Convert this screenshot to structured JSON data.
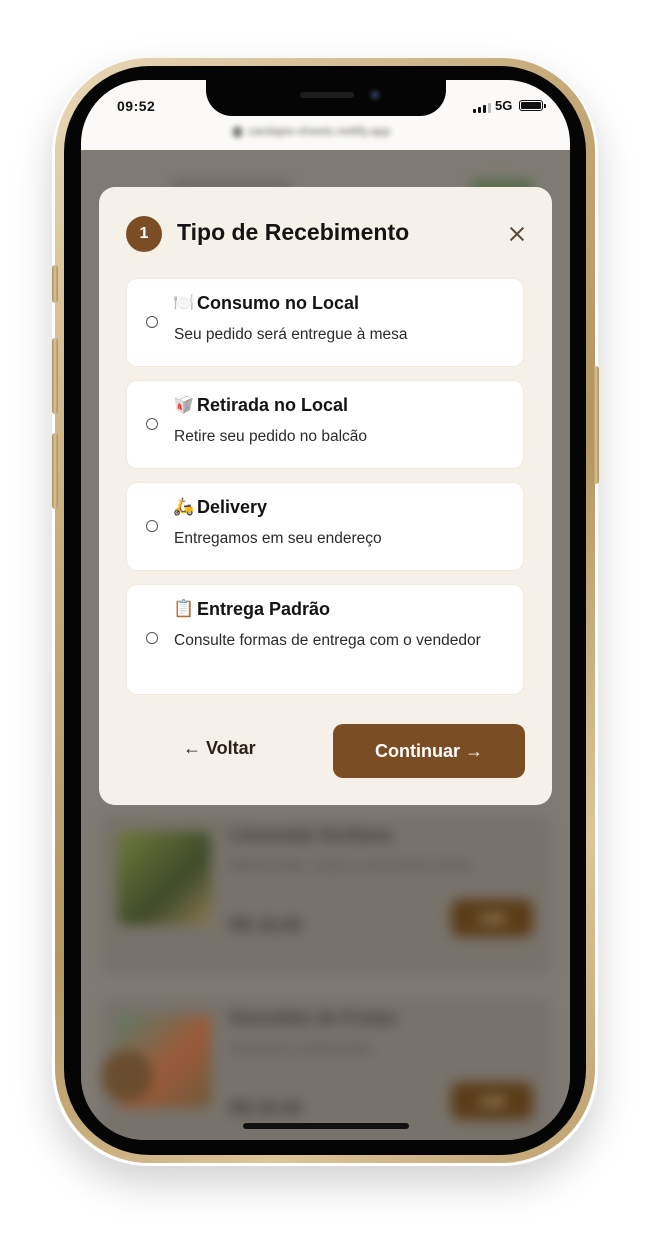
{
  "status_bar": {
    "time": "09:52",
    "network": "5G"
  },
  "browser": {
    "url": "cardapio-sheets.netlify.app"
  },
  "modal": {
    "step_number": "1",
    "title": "Tipo de Recebimento",
    "options": [
      {
        "icon": "🍽️",
        "icon_name": "plate-cutlery-icon",
        "title": "Consumo no Local",
        "description": "Seu pedido será entregue à mesa",
        "selected": false
      },
      {
        "icon": "🥡",
        "icon_name": "takeout-box-icon",
        "title": "Retirada no Local",
        "description": "Retire seu pedido no balcão",
        "selected": false
      },
      {
        "icon": "🛵",
        "icon_name": "scooter-icon",
        "title": "Delivery",
        "description": "Entregamos em seu endereço",
        "selected": false
      },
      {
        "icon": "📋",
        "icon_name": "clipboard-icon",
        "title": "Entrega Padrão",
        "description": "Consulte formas de entrega com o vendedor",
        "selected": false
      }
    ],
    "back_label": "← Voltar",
    "continue_label": "Continuar →"
  },
  "background_page": {
    "items": [
      {
        "name": "Limonada Siciliana",
        "description": "Refrescante, suave e levemente cítrica",
        "price": "R$ 16,00",
        "add_label": "Add"
      },
      {
        "name": "Smoothie de Frutas",
        "description": "Cremoso e refrescante",
        "price": "R$ 20,00",
        "add_label": "Add"
      }
    ]
  },
  "colors": {
    "accent": "#7b4d24",
    "modal_bg": "#f6f1e8",
    "overlay": "#8f8a80"
  }
}
